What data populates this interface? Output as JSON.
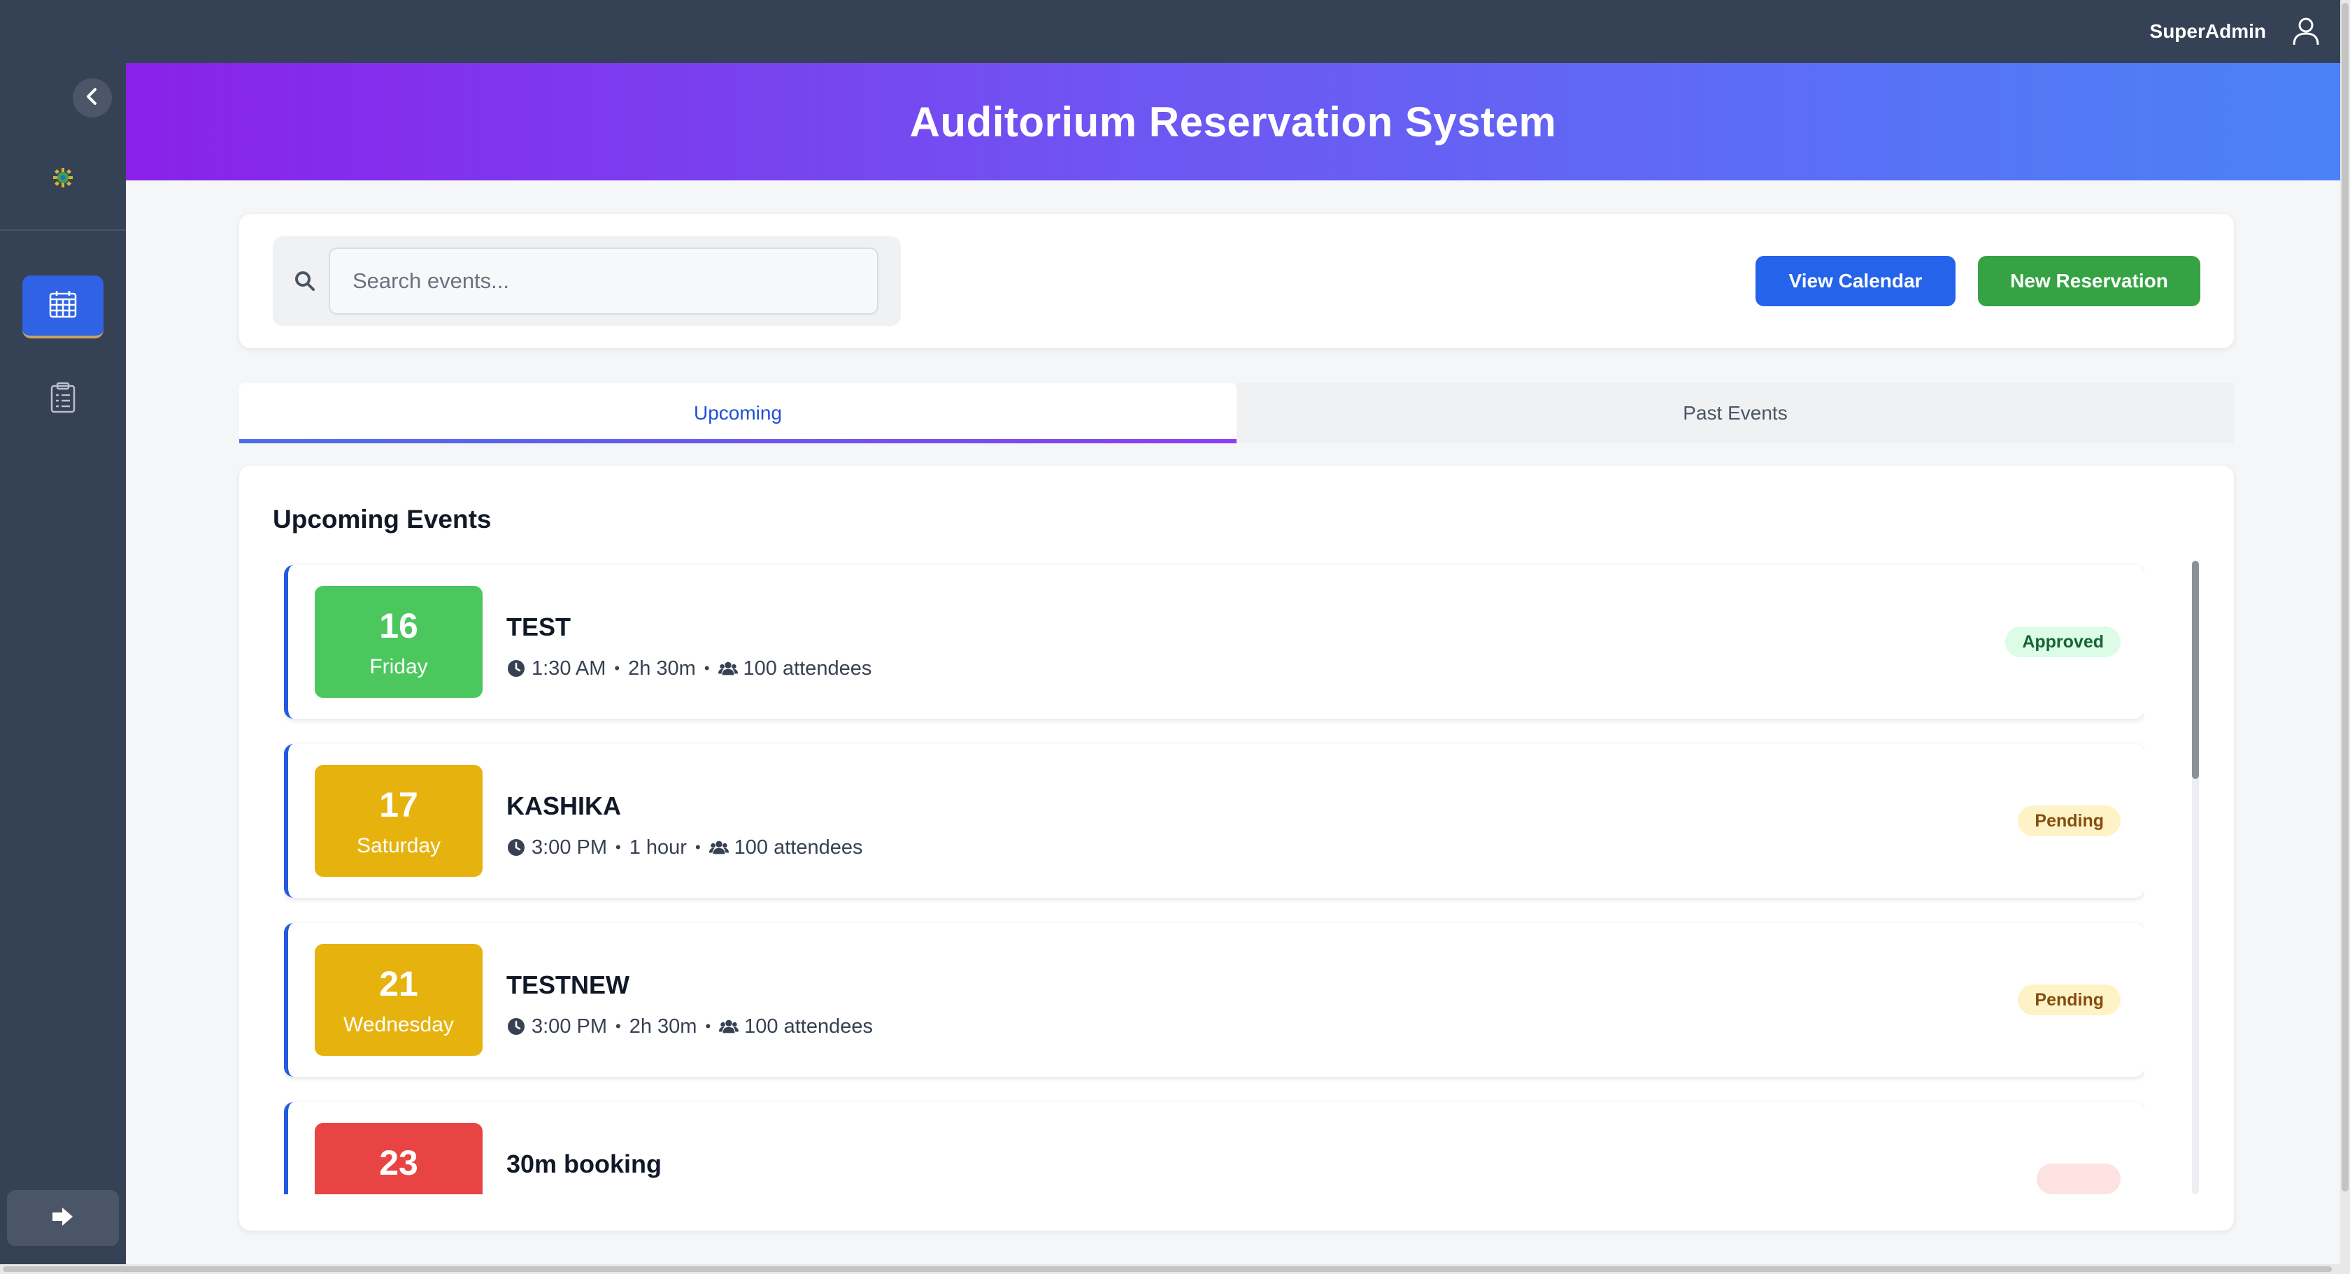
{
  "topbar": {
    "user_name": "SuperAdmin"
  },
  "header": {
    "title": "Auditorium Reservation System"
  },
  "search": {
    "placeholder": "Search events..."
  },
  "toolbar": {
    "view_calendar_label": "View Calendar",
    "new_reservation_label": "New Reservation"
  },
  "tabs": [
    {
      "label": "Upcoming",
      "active": true
    },
    {
      "label": "Past Events",
      "active": false
    }
  ],
  "events_section": {
    "title": "Upcoming Events"
  },
  "events": [
    {
      "day": "16",
      "weekday": "Friday",
      "name": "TEST",
      "time": "1:30 AM",
      "duration": "2h 30m",
      "attendees": "100 attendees",
      "status": "Approved",
      "date_color": "#4bc75e"
    },
    {
      "day": "17",
      "weekday": "Saturday",
      "name": "KASHIKA",
      "time": "3:00 PM",
      "duration": "1 hour",
      "attendees": "100 attendees",
      "status": "Pending",
      "date_color": "#e6b20e"
    },
    {
      "day": "21",
      "weekday": "Wednesday",
      "name": "TESTNEW",
      "time": "3:00 PM",
      "duration": "2h 30m",
      "attendees": "100 attendees",
      "status": "Pending",
      "date_color": "#e6b20e"
    },
    {
      "day": "23",
      "weekday": "",
      "name": "30m booking",
      "time": "",
      "duration": "",
      "attendees": "",
      "status": "",
      "date_color": "#e84444"
    }
  ],
  "icons": {
    "user": "user-icon",
    "collapse": "chevron-left-icon",
    "logo": "gear-logo-icon",
    "nav_calendar": "calendar-icon",
    "nav_reports": "clipboard-icon",
    "logout": "logout-icon",
    "search": "search-icon",
    "clock": "clock-icon",
    "attendees": "users-icon"
  },
  "colors": {
    "topbar": "#354154",
    "primary": "#2563eb",
    "success": "#35a343",
    "accent_border": "#2459e0"
  }
}
